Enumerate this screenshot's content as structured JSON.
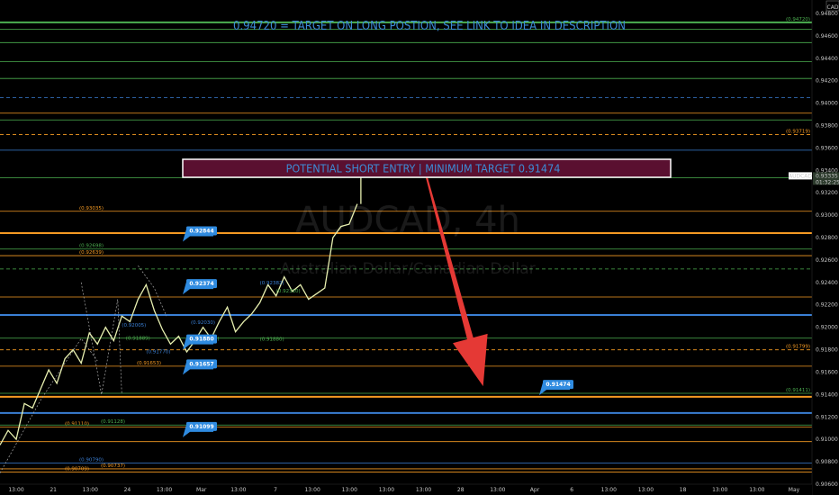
{
  "headline": "0.94720 = TARGET ON LONG POSTION, SEE LINK TO IDEA IN DESCRIPTION",
  "entry_box": "POTENTIAL SHORT ENTRY | MINIMUM TARGET 0.91474",
  "watermark": {
    "symbol": "AUDCAD, 4h",
    "name": "Australian Dollar/Canadian Dollar"
  },
  "axis": {
    "currency": "CAD"
  },
  "colors": {
    "background": "#000000",
    "green": "#4caf50",
    "orange": "#f59a23",
    "blue": "#3a7fd5",
    "red": "#e53935",
    "entry_box": "#5a1030",
    "tag": "#2f8be0"
  },
  "chart_data": {
    "type": "line",
    "symbol": "AUDCAD",
    "timeframe": "4h",
    "ylim": [
      0.906,
      0.9492
    ],
    "price_ticks": [
      "0.94800",
      "0.94600",
      "0.94400",
      "0.94200",
      "0.94000",
      "0.93800",
      "0.93600",
      "0.93400",
      "0.93200",
      "0.93000",
      "0.92800",
      "0.92600",
      "0.92400",
      "0.92200",
      "0.92000",
      "0.91800",
      "0.91600",
      "0.91400",
      "0.91200",
      "0.91000",
      "0.90800",
      "0.90600"
    ],
    "time_labels": [
      "13:00",
      "21",
      "13:00",
      "24",
      "13:00",
      "Mar",
      "13:00",
      "7",
      "13:00",
      "13:00",
      "13:00",
      "13:00",
      "28",
      "13:00",
      "Apr",
      "6",
      "13:00",
      "13:00",
      "18",
      "13:00",
      "13:00",
      "May"
    ],
    "levels": [
      {
        "price": 0.9472,
        "color": "#4caf50",
        "style": "solid",
        "thick": true,
        "label": "(0.94720)"
      },
      {
        "price": 0.9466,
        "color": "#4caf50",
        "style": "solid",
        "label": ""
      },
      {
        "price": 0.9454,
        "color": "#4caf50",
        "style": "solid",
        "label": ""
      },
      {
        "price": 0.9437,
        "color": "#4caf50",
        "style": "solid",
        "label": ""
      },
      {
        "price": 0.9422,
        "color": "#4caf50",
        "style": "solid",
        "label": ""
      },
      {
        "price": 0.9405,
        "color": "#3a7fd5",
        "style": "dashed",
        "label": ""
      },
      {
        "price": 0.9391,
        "color": "#f59a23",
        "style": "solid",
        "label": ""
      },
      {
        "price": 0.9385,
        "color": "#4caf50",
        "style": "solid",
        "label": ""
      },
      {
        "price": 0.93719,
        "color": "#f59a23",
        "style": "dashed",
        "label": "(0.93719)"
      },
      {
        "price": 0.9358,
        "color": "#3a7fd5",
        "style": "solid",
        "label": ""
      },
      {
        "price": 0.93335,
        "color": "#4caf50",
        "style": "solid",
        "label": ""
      },
      {
        "price": 0.93035,
        "color": "#f59a23",
        "style": "solid",
        "label": "(0.93035)"
      },
      {
        "price": 0.9284,
        "color": "#f59a23",
        "style": "solid",
        "thick": true,
        "label": ""
      },
      {
        "price": 0.92698,
        "color": "#4caf50",
        "style": "solid",
        "label": "(0.92698)"
      },
      {
        "price": 0.92639,
        "color": "#f59a23",
        "style": "solid",
        "label": "(0.92639)"
      },
      {
        "price": 0.9252,
        "color": "#4caf50",
        "style": "dashed",
        "label": ""
      },
      {
        "price": 0.9227,
        "color": "#f59a23",
        "style": "solid",
        "label": ""
      },
      {
        "price": 0.9211,
        "color": "#3a7fd5",
        "style": "solid",
        "thick": true,
        "label": ""
      },
      {
        "price": 0.91903,
        "color": "#4caf50",
        "style": "solid",
        "label": ""
      },
      {
        "price": 0.91799,
        "color": "#f59a23",
        "style": "dashed",
        "label": "(0.91799)"
      },
      {
        "price": 0.91653,
        "color": "#f59a23",
        "style": "solid",
        "label": "(0.91653)"
      },
      {
        "price": 0.91411,
        "color": "#4caf50",
        "style": "solid",
        "label": "(0.91411)"
      },
      {
        "price": 0.9138,
        "color": "#f59a23",
        "style": "solid",
        "thick": true,
        "label": ""
      },
      {
        "price": 0.91235,
        "color": "#3a7fd5",
        "style": "solid",
        "thick": true,
        "label": ""
      },
      {
        "price": 0.9111,
        "color": "#f59a23",
        "style": "solid",
        "label": "(0.91110)"
      },
      {
        "price": 0.91128,
        "color": "#4caf50",
        "style": "solid",
        "label": "(0.91128)"
      },
      {
        "price": 0.9098,
        "color": "#f59a23",
        "style": "solid",
        "label": ""
      },
      {
        "price": 0.9079,
        "color": "#3a7fd5",
        "style": "solid",
        "label": "(0.90790)"
      },
      {
        "price": 0.90737,
        "color": "#f59a23",
        "style": "solid",
        "label": "(0.90737)"
      },
      {
        "price": 0.90709,
        "color": "#f59a23",
        "style": "solid",
        "label": "(0.90709)"
      }
    ],
    "left_labels": [
      {
        "price": 0.92382,
        "text": "(0.92382)",
        "color": "#3a7fd5",
        "t": 0.32
      },
      {
        "price": 0.9231,
        "text": "(0.92310)",
        "color": "#4caf50",
        "t": 0.34
      },
      {
        "price": 0.92005,
        "text": "(0.92005)",
        "color": "#3a7fd5",
        "t": 0.15
      },
      {
        "price": 0.9203,
        "text": "(0.92030)",
        "color": "#3a7fd5",
        "t": 0.235
      },
      {
        "price": 0.9188,
        "text": "(0.91880)",
        "color": "#4caf50",
        "t": 0.32
      },
      {
        "price": 0.91889,
        "text": "(0.91889)",
        "color": "#4caf50",
        "t": 0.155
      },
      {
        "price": 0.91883,
        "text": "(0.91883)",
        "color": "#4caf50",
        "t": 0.24
      },
      {
        "price": 0.9177,
        "text": "(0.91770)",
        "color": "#3a7fd5",
        "t": 0.18
      }
    ],
    "price_tags": [
      {
        "price": 0.92844,
        "text": "0.92844",
        "t": 0.44
      },
      {
        "price": 0.92374,
        "text": "0.92374",
        "t": 0.44
      },
      {
        "price": 0.9188,
        "text": "0.91880",
        "t": 0.44
      },
      {
        "price": 0.91657,
        "text": "0.91657",
        "t": 0.44
      },
      {
        "price": 0.91099,
        "text": "0.91099",
        "t": 0.44
      },
      {
        "price": 0.91474,
        "text": "0.91474",
        "t": 0.595
      }
    ],
    "current_price": {
      "price": 0.93335,
      "symbol": "AUDCAD",
      "value": "0.93335",
      "countdown": "01:32:25"
    },
    "price_series": [
      [
        0.0,
        0.9095
      ],
      [
        0.01,
        0.9108
      ],
      [
        0.02,
        0.91
      ],
      [
        0.03,
        0.9132
      ],
      [
        0.04,
        0.9128
      ],
      [
        0.05,
        0.9145
      ],
      [
        0.06,
        0.9162
      ],
      [
        0.07,
        0.915
      ],
      [
        0.08,
        0.9172
      ],
      [
        0.09,
        0.918
      ],
      [
        0.1,
        0.9168
      ],
      [
        0.11,
        0.9195
      ],
      [
        0.12,
        0.9185
      ],
      [
        0.13,
        0.92
      ],
      [
        0.14,
        0.9188
      ],
      [
        0.15,
        0.921
      ],
      [
        0.16,
        0.9205
      ],
      [
        0.17,
        0.9225
      ],
      [
        0.18,
        0.9238
      ],
      [
        0.19,
        0.9215
      ],
      [
        0.2,
        0.9198
      ],
      [
        0.21,
        0.9185
      ],
      [
        0.22,
        0.9192
      ],
      [
        0.23,
        0.9178
      ],
      [
        0.24,
        0.9188
      ],
      [
        0.25,
        0.92
      ],
      [
        0.26,
        0.919
      ],
      [
        0.27,
        0.9205
      ],
      [
        0.28,
        0.9218
      ],
      [
        0.29,
        0.9196
      ],
      [
        0.3,
        0.9205
      ],
      [
        0.31,
        0.9212
      ],
      [
        0.32,
        0.9222
      ],
      [
        0.33,
        0.9238
      ],
      [
        0.34,
        0.9228
      ],
      [
        0.35,
        0.9245
      ],
      [
        0.36,
        0.9232
      ],
      [
        0.37,
        0.9238
      ],
      [
        0.38,
        0.9225
      ],
      [
        0.39,
        0.923
      ],
      [
        0.4,
        0.9235
      ],
      [
        0.41,
        0.928
      ],
      [
        0.42,
        0.929
      ],
      [
        0.43,
        0.9292
      ],
      [
        0.44,
        0.931
      ]
    ],
    "arrow": {
      "from_t": 0.525,
      "from_price": 0.9335,
      "to_t": 0.595,
      "to_price": 0.91474
    }
  }
}
